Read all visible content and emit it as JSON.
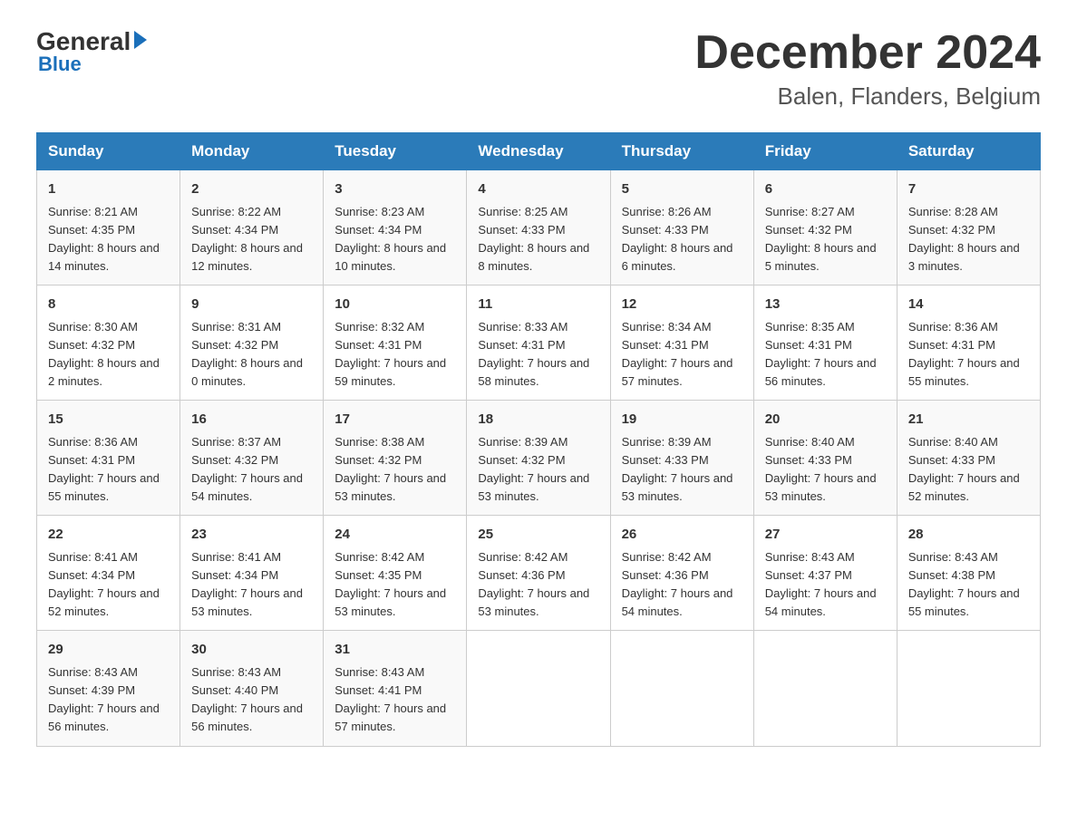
{
  "logo": {
    "general": "General",
    "arrow": "",
    "blue": "Blue"
  },
  "title": "December 2024",
  "location": "Balen, Flanders, Belgium",
  "days_of_week": [
    "Sunday",
    "Monday",
    "Tuesday",
    "Wednesday",
    "Thursday",
    "Friday",
    "Saturday"
  ],
  "weeks": [
    [
      {
        "day": "1",
        "sunrise": "8:21 AM",
        "sunset": "4:35 PM",
        "daylight": "8 hours and 14 minutes."
      },
      {
        "day": "2",
        "sunrise": "8:22 AM",
        "sunset": "4:34 PM",
        "daylight": "8 hours and 12 minutes."
      },
      {
        "day": "3",
        "sunrise": "8:23 AM",
        "sunset": "4:34 PM",
        "daylight": "8 hours and 10 minutes."
      },
      {
        "day": "4",
        "sunrise": "8:25 AM",
        "sunset": "4:33 PM",
        "daylight": "8 hours and 8 minutes."
      },
      {
        "day": "5",
        "sunrise": "8:26 AM",
        "sunset": "4:33 PM",
        "daylight": "8 hours and 6 minutes."
      },
      {
        "day": "6",
        "sunrise": "8:27 AM",
        "sunset": "4:32 PM",
        "daylight": "8 hours and 5 minutes."
      },
      {
        "day": "7",
        "sunrise": "8:28 AM",
        "sunset": "4:32 PM",
        "daylight": "8 hours and 3 minutes."
      }
    ],
    [
      {
        "day": "8",
        "sunrise": "8:30 AM",
        "sunset": "4:32 PM",
        "daylight": "8 hours and 2 minutes."
      },
      {
        "day": "9",
        "sunrise": "8:31 AM",
        "sunset": "4:32 PM",
        "daylight": "8 hours and 0 minutes."
      },
      {
        "day": "10",
        "sunrise": "8:32 AM",
        "sunset": "4:31 PM",
        "daylight": "7 hours and 59 minutes."
      },
      {
        "day": "11",
        "sunrise": "8:33 AM",
        "sunset": "4:31 PM",
        "daylight": "7 hours and 58 minutes."
      },
      {
        "day": "12",
        "sunrise": "8:34 AM",
        "sunset": "4:31 PM",
        "daylight": "7 hours and 57 minutes."
      },
      {
        "day": "13",
        "sunrise": "8:35 AM",
        "sunset": "4:31 PM",
        "daylight": "7 hours and 56 minutes."
      },
      {
        "day": "14",
        "sunrise": "8:36 AM",
        "sunset": "4:31 PM",
        "daylight": "7 hours and 55 minutes."
      }
    ],
    [
      {
        "day": "15",
        "sunrise": "8:36 AM",
        "sunset": "4:31 PM",
        "daylight": "7 hours and 55 minutes."
      },
      {
        "day": "16",
        "sunrise": "8:37 AM",
        "sunset": "4:32 PM",
        "daylight": "7 hours and 54 minutes."
      },
      {
        "day": "17",
        "sunrise": "8:38 AM",
        "sunset": "4:32 PM",
        "daylight": "7 hours and 53 minutes."
      },
      {
        "day": "18",
        "sunrise": "8:39 AM",
        "sunset": "4:32 PM",
        "daylight": "7 hours and 53 minutes."
      },
      {
        "day": "19",
        "sunrise": "8:39 AM",
        "sunset": "4:33 PM",
        "daylight": "7 hours and 53 minutes."
      },
      {
        "day": "20",
        "sunrise": "8:40 AM",
        "sunset": "4:33 PM",
        "daylight": "7 hours and 53 minutes."
      },
      {
        "day": "21",
        "sunrise": "8:40 AM",
        "sunset": "4:33 PM",
        "daylight": "7 hours and 52 minutes."
      }
    ],
    [
      {
        "day": "22",
        "sunrise": "8:41 AM",
        "sunset": "4:34 PM",
        "daylight": "7 hours and 52 minutes."
      },
      {
        "day": "23",
        "sunrise": "8:41 AM",
        "sunset": "4:34 PM",
        "daylight": "7 hours and 53 minutes."
      },
      {
        "day": "24",
        "sunrise": "8:42 AM",
        "sunset": "4:35 PM",
        "daylight": "7 hours and 53 minutes."
      },
      {
        "day": "25",
        "sunrise": "8:42 AM",
        "sunset": "4:36 PM",
        "daylight": "7 hours and 53 minutes."
      },
      {
        "day": "26",
        "sunrise": "8:42 AM",
        "sunset": "4:36 PM",
        "daylight": "7 hours and 54 minutes."
      },
      {
        "day": "27",
        "sunrise": "8:43 AM",
        "sunset": "4:37 PM",
        "daylight": "7 hours and 54 minutes."
      },
      {
        "day": "28",
        "sunrise": "8:43 AM",
        "sunset": "4:38 PM",
        "daylight": "7 hours and 55 minutes."
      }
    ],
    [
      {
        "day": "29",
        "sunrise": "8:43 AM",
        "sunset": "4:39 PM",
        "daylight": "7 hours and 56 minutes."
      },
      {
        "day": "30",
        "sunrise": "8:43 AM",
        "sunset": "4:40 PM",
        "daylight": "7 hours and 56 minutes."
      },
      {
        "day": "31",
        "sunrise": "8:43 AM",
        "sunset": "4:41 PM",
        "daylight": "7 hours and 57 minutes."
      },
      null,
      null,
      null,
      null
    ]
  ]
}
